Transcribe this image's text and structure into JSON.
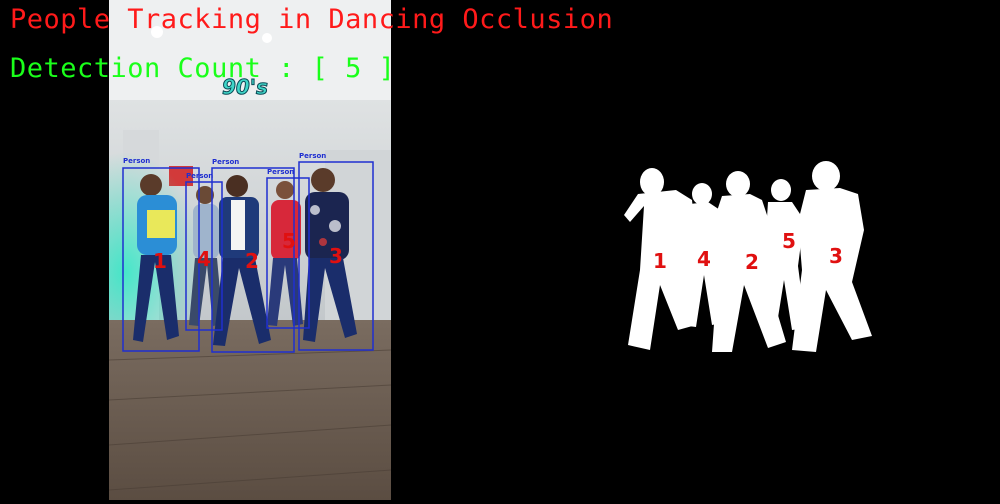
{
  "title": "People Tracking in Dancing Occlusion",
  "detection": {
    "label": "Detection Count : [ 5 ]"
  },
  "video_watermark": "90's",
  "detections": [
    {
      "class_label": "Person",
      "track_id": "1"
    },
    {
      "class_label": "Person",
      "track_id": "4"
    },
    {
      "class_label": "Person",
      "track_id": "2"
    },
    {
      "class_label": "Person",
      "track_id": "5"
    },
    {
      "class_label": "Person",
      "track_id": "3"
    }
  ],
  "mask_ids": [
    "1",
    "4",
    "2",
    "5",
    "3"
  ],
  "colors": {
    "title": "#ff1a1a",
    "count": "#1aff1a",
    "box": "#1f2fd0",
    "track_id": "#e01010",
    "watermark": "#3fd6c8",
    "mask": "#ffffff"
  }
}
